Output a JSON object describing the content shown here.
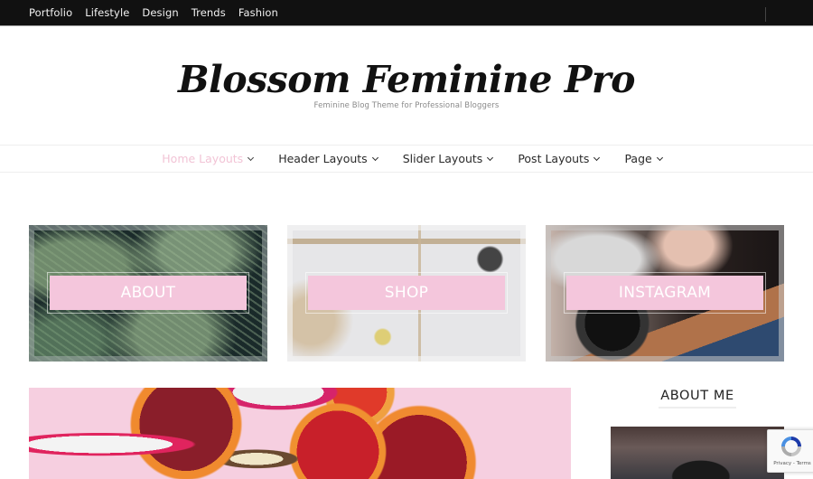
{
  "topbar": {
    "menu": [
      "Portfolio",
      "Lifestyle",
      "Design",
      "Trends",
      "Fashion"
    ]
  },
  "branding": {
    "title": "Blossom Feminine Pro",
    "description": "Feminine Blog Theme for Professional Bloggers"
  },
  "main_nav": {
    "items": [
      {
        "label": "Home Layouts",
        "active": true,
        "has_submenu": true
      },
      {
        "label": "Header Layouts",
        "active": false,
        "has_submenu": true
      },
      {
        "label": "Slider Layouts",
        "active": false,
        "has_submenu": true
      },
      {
        "label": "Post Layouts",
        "active": false,
        "has_submenu": true
      },
      {
        "label": "Page",
        "active": false,
        "has_submenu": true
      }
    ]
  },
  "promo_blocks": [
    {
      "label": "ABOUT",
      "image": "fern-leaves"
    },
    {
      "label": "SHOP",
      "image": "driftwood-shelves"
    },
    {
      "label": "INSTAGRAM",
      "image": "pentax-camera"
    }
  ],
  "featured_post": {
    "image": "sliced-citrus-and-dragonfruit"
  },
  "sidebar": {
    "widget_title": "ABOUT ME",
    "image": "person-in-beanie"
  },
  "recaptcha": {
    "terms": "Privacy - Terms"
  },
  "colors": {
    "accent_pink": "#f4c6dc",
    "active_nav": "#f2c4d6",
    "topbar_bg": "#111111"
  }
}
